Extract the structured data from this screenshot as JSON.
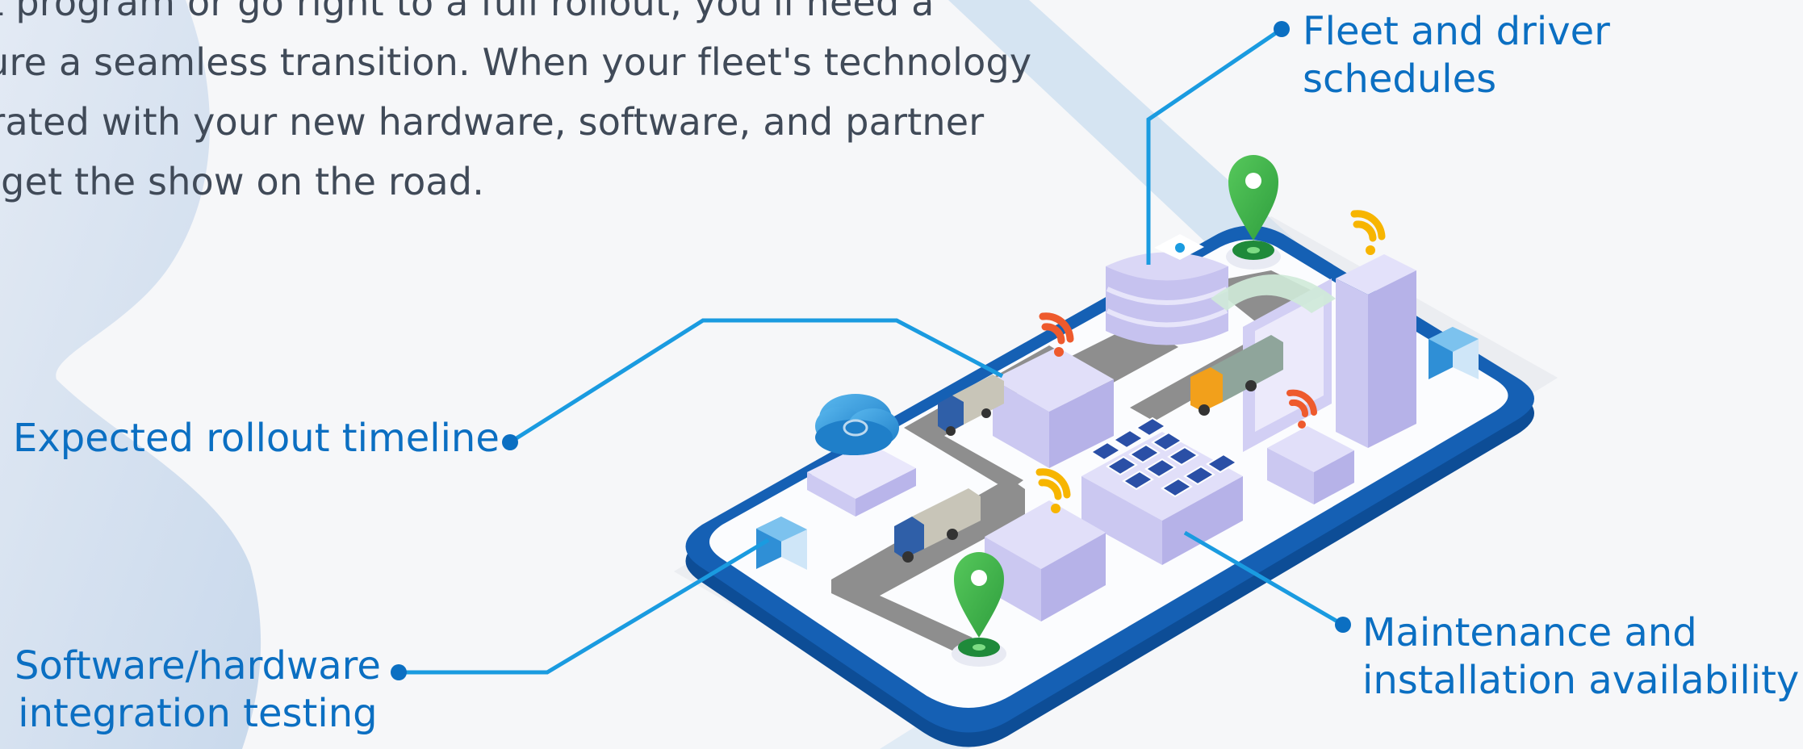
{
  "intro": {
    "lines": [
      "ot program or go right to a full rollout, you'll need a",
      "sure a seamless transition. When your fleet's technology",
      "grated with your new hardware, software, and partner",
      "o get the show on the road."
    ]
  },
  "callouts": {
    "fleet_schedules": [
      "Fleet and driver",
      "schedules"
    ],
    "rollout_timeline": [
      "Expected rollout timeline"
    ],
    "integration_testing": [
      "Software/hardware",
      "integration testing"
    ],
    "maintenance": [
      "Maintenance and",
      "installation availability"
    ]
  },
  "colors": {
    "callout_text": "#0b6fc2",
    "leader_line": "#1a9be0",
    "body_text": "#404a58",
    "platform_rim": "#1560b4",
    "building": "#d6d3f4",
    "road": "#8e8e8e",
    "pin": "#3ab54a",
    "wifi_orange": "#ee5a2d",
    "wifi_yellow": "#f7b500"
  },
  "icons": [
    "cloud-icon",
    "location-pin-icon",
    "wifi-signal-icon",
    "truck-icon",
    "solar-panel-icon",
    "server-icon"
  ]
}
